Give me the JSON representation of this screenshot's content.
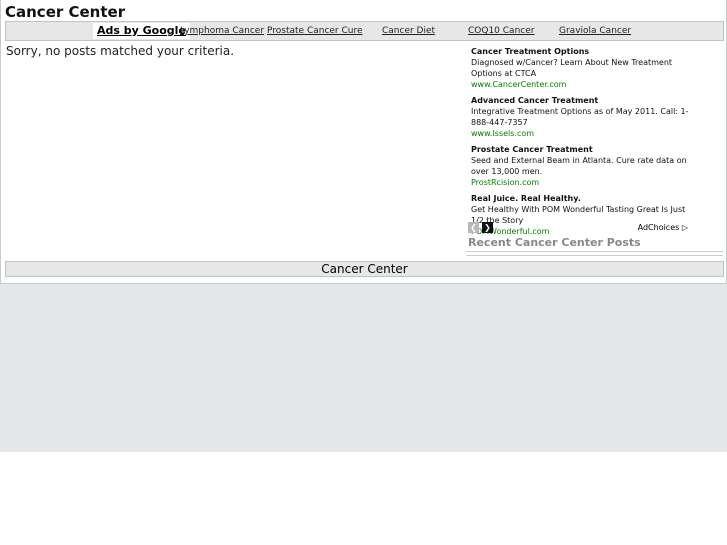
{
  "header": {
    "site_title": "Cancer Center"
  },
  "linkbar": {
    "ads_label": "Ads by Google",
    "links": [
      "Lymphoma Cancer",
      "Prostate Cancer Cure",
      "Cancer Diet",
      "COQ10 Cancer",
      "Graviola Cancer"
    ]
  },
  "main": {
    "message": "Sorry, no posts matched your criteria."
  },
  "ads": [
    {
      "title": "Cancer Treatment Options",
      "desc": "Diagnosed w/Cancer? Learn About New Treatment Options at CTCA",
      "url": "www.CancerCenter.com"
    },
    {
      "title": "Advanced Cancer Treatment",
      "desc": "Integrative Treatment Options as of May 2011. Call: 1-888-447-7357",
      "url": "www.Issels.com"
    },
    {
      "title": "Prostate Cancer Treatment",
      "desc": "Seed and External Beam in Atlanta. Cure rate data on over 13,000 men.",
      "url": "ProstRcision.com"
    },
    {
      "title": "Real Juice. Real Healthy.",
      "desc": "Get Healthy With POM Wonderful Tasting Great Is Just 1/2 the Story",
      "url": "POMWonderful.com"
    }
  ],
  "ad_nav": {
    "prev_icon": "chevron-left-icon",
    "next_icon": "chevron-right-icon",
    "adchoices_label": "AdChoices"
  },
  "sidebar": {
    "recent_title": "Recent Cancer Center Posts"
  },
  "footer": {
    "title": "Cancer Center"
  },
  "colors": {
    "page_bg": "#e4e7e7",
    "bar_bg": "#e6e8e8",
    "ad_url": "#008000",
    "recent_title": "#888888"
  }
}
